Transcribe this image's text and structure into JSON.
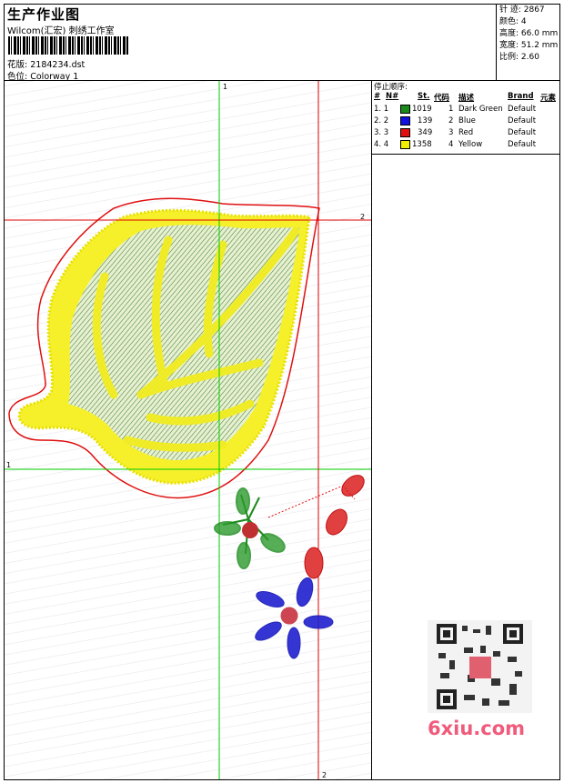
{
  "header": {
    "title": "生产作业图",
    "studio": "Wilcom(汇宏) 刺绣工作室",
    "design_label": "花版:",
    "design_file": "2184234.dst",
    "colorway_label": "色位:",
    "colorway": "Colorway 1"
  },
  "stats": {
    "stitches": "针 迹: 2867",
    "colors": "颜色: 4",
    "height": "高度: 66.0 mm",
    "width": "宽度: 51.2 mm",
    "scale": "比例: 2.60"
  },
  "stop_sequence": {
    "title": "停止顺序:",
    "headers": [
      "#",
      "N#",
      "St.",
      "代码",
      "描述",
      "Brand",
      "元素"
    ],
    "rows": [
      {
        "idx": "1. 1",
        "color": "#1a8a1a",
        "st": "1019",
        "code": "1",
        "desc": "Dark Green",
        "brand": "Default"
      },
      {
        "idx": "2. 2",
        "color": "#1010e0",
        "st": "139",
        "code": "2",
        "desc": "Blue",
        "brand": "Default"
      },
      {
        "idx": "3. 3",
        "color": "#e01010",
        "st": "349",
        "code": "3",
        "desc": "Red",
        "brand": "Default"
      },
      {
        "idx": "4. 4",
        "color": "#f0f000",
        "st": "1358",
        "code": "4",
        "desc": "Yellow",
        "brand": "Default"
      }
    ]
  },
  "guides": {
    "v1_label_top": "1",
    "h1_label_left": "1",
    "h2_label_right": "2",
    "v2_label_bottom": "2",
    "v1_color": "#00cc00",
    "v2_color": "#e00000"
  },
  "watermark": {
    "text": "6xiu.com"
  }
}
